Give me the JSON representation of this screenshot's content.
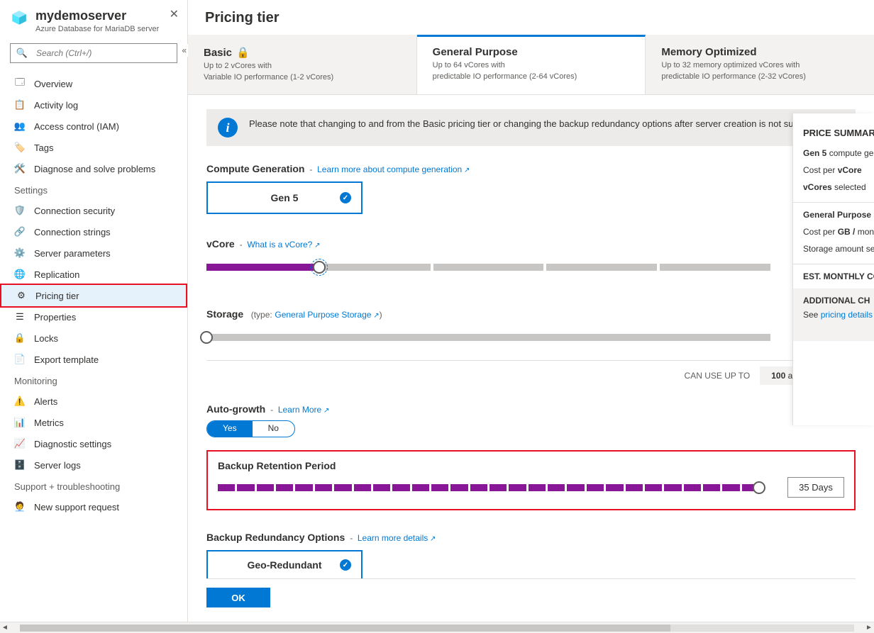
{
  "sidebar": {
    "title": "mydemoserver",
    "subtitle": "Azure Database for MariaDB server",
    "search_placeholder": "Search (Ctrl+/)",
    "top": [
      {
        "label": "Overview"
      },
      {
        "label": "Activity log"
      },
      {
        "label": "Access control (IAM)"
      },
      {
        "label": "Tags"
      },
      {
        "label": "Diagnose and solve problems"
      }
    ],
    "settings_header": "Settings",
    "settings": [
      {
        "label": "Connection security"
      },
      {
        "label": "Connection strings"
      },
      {
        "label": "Server parameters"
      },
      {
        "label": "Replication"
      },
      {
        "label": "Pricing tier",
        "selected": true
      },
      {
        "label": "Properties"
      },
      {
        "label": "Locks"
      },
      {
        "label": "Export template"
      }
    ],
    "monitoring_header": "Monitoring",
    "monitoring": [
      {
        "label": "Alerts"
      },
      {
        "label": "Metrics"
      },
      {
        "label": "Diagnostic settings"
      },
      {
        "label": "Server logs"
      }
    ],
    "support_header": "Support + troubleshooting",
    "support": [
      {
        "label": "New support request"
      }
    ]
  },
  "main": {
    "title": "Pricing tier",
    "tabs": [
      {
        "name": "Basic",
        "locked": true,
        "line1": "Up to 2 vCores with",
        "line2": "Variable IO performance (1-2 vCores)"
      },
      {
        "name": "General Purpose",
        "active": true,
        "line1": "Up to 64 vCores with",
        "line2": "predictable IO performance (2-64 vCores)"
      },
      {
        "name": "Memory Optimized",
        "line1": "Up to 32 memory optimized vCores with",
        "line2": "predictable IO performance (2-32 vCores)"
      }
    ],
    "info": "Please note that changing to and from the Basic pricing tier or changing the backup redundancy options after server creation is not supported.",
    "compute": {
      "label": "Compute Generation",
      "link": "Learn more about compute generation",
      "value": "Gen 5"
    },
    "vcore": {
      "label": "vCore",
      "link": "What is a vCore?",
      "value": "4 vCores"
    },
    "storage": {
      "label": "Storage",
      "type_prefix": "(type:",
      "type_link": "General Purpose Storage",
      "type_suffix": ")",
      "value": "5 GB"
    },
    "iops": {
      "label": "CAN USE UP TO",
      "num": "100",
      "suffix": "available IOPS"
    },
    "autogrowth": {
      "label": "Auto-growth",
      "link": "Learn More",
      "yes": "Yes",
      "no": "No"
    },
    "backup": {
      "label": "Backup Retention Period",
      "value": "35 Days"
    },
    "redundancy": {
      "label": "Backup Redundancy Options",
      "link": "Learn more details",
      "value": "Geo-Redundant"
    },
    "ok": "OK"
  },
  "price": {
    "title": "PRICE SUMMARY",
    "l1a": "Gen 5",
    "l1b": " compute gen",
    "l2a": "Cost per ",
    "l2b": "vCore",
    "l3a": "vCores",
    "l3b": " selected",
    "l4": "General Purpose S",
    "l5a": "Cost per ",
    "l5b": "GB / ",
    "l5c": "mont",
    "l6": "Storage amount sel",
    "est": "EST. MONTHLY CO",
    "addl_h": "ADDITIONAL CH",
    "addl_pre": "See ",
    "addl_link": "pricing details f"
  }
}
